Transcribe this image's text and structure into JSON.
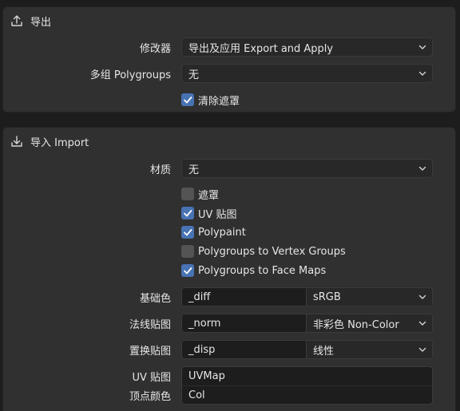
{
  "export": {
    "title": "导出",
    "modifier_label": "修改器",
    "modifier_value": "导出及应用 Export and Apply",
    "polygroups_label": "多组 Polygroups",
    "polygroups_value": "无",
    "clear_mask_label": "清除遮罩",
    "clear_mask_checked": true
  },
  "import": {
    "title": "导入 Import",
    "material_label": "材质",
    "material_value": "无",
    "checks": [
      {
        "label": "遮罩",
        "checked": false
      },
      {
        "label": "UV 贴图",
        "checked": true
      },
      {
        "label": "Polypaint",
        "checked": true
      },
      {
        "label": "Polygroups to Vertex Groups",
        "checked": false
      },
      {
        "label": "Polygroups to Face Maps",
        "checked": true
      }
    ],
    "base_color_label": "基础色",
    "base_color_suffix": "_diff",
    "base_color_space": "sRGB",
    "normal_label": "法线贴图",
    "normal_suffix": "_norm",
    "normal_space": "非彩色 Non-Color",
    "displacement_label": "置换贴图",
    "displacement_suffix": "_disp",
    "displacement_space": "线性",
    "uv_label": "UV 贴图",
    "uv_value": "UVMap",
    "vertex_color_label": "顶点颜色",
    "vertex_color_value": "Col"
  },
  "colors": {
    "background": "#1d1d1d",
    "panel": "#303030",
    "field": "#282828",
    "text_field": "#1d1d1d",
    "accent": "#4772b3",
    "checkbox_off": "#545454"
  }
}
